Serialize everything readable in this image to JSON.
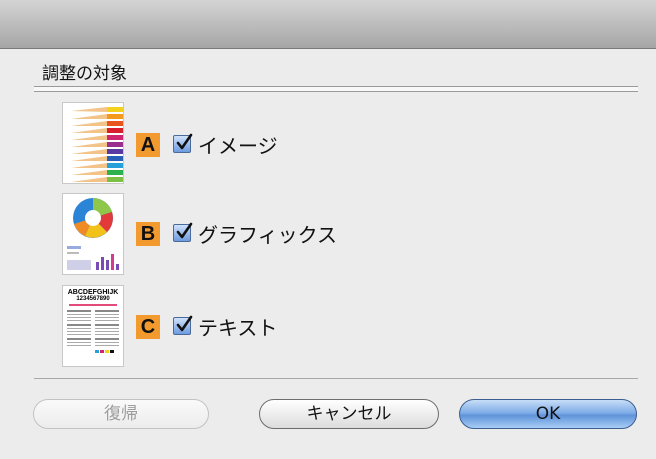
{
  "dialog": {
    "section_title": "調整の対象"
  },
  "options": [
    {
      "letter": "A",
      "label": "イメージ",
      "checked": true,
      "thumbnail": "colored-pencils"
    },
    {
      "letter": "B",
      "label": "グラフィックス",
      "checked": true,
      "thumbnail": "pie-and-bar-graphics"
    },
    {
      "letter": "C",
      "label": "テキスト",
      "checked": true,
      "thumbnail": "text-document",
      "thumbnail_text": {
        "line1": "ABCDEFGHIJK",
        "line2": "1234567890"
      }
    }
  ],
  "buttons": {
    "revert": "復帰",
    "cancel": "キャンセル",
    "ok": "OK"
  },
  "colors": {
    "letter_badge": "#f29a2e",
    "checkbox": "#6d9be0",
    "ok_button": "#80aee8"
  }
}
